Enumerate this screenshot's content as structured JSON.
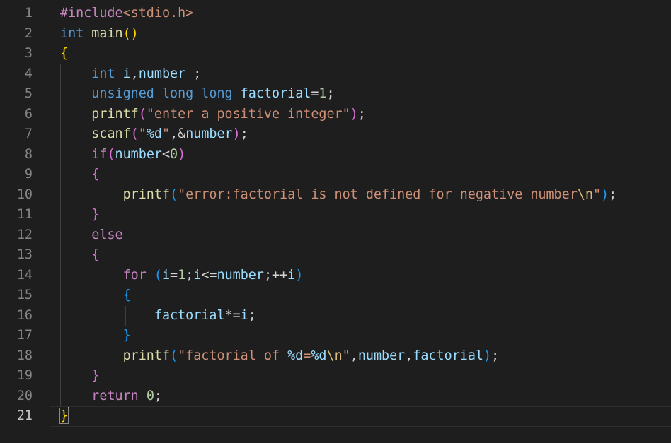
{
  "editor": {
    "language": "c",
    "current_line": 21,
    "colors": {
      "background": "#1e1e1e",
      "keyword_control": "#c586c0",
      "keyword_type": "#569cd6",
      "function": "#dcdcaa",
      "variable": "#9cdcfe",
      "string": "#ce9178",
      "number": "#b5cea8",
      "bracket_1": "#ffd700",
      "bracket_2": "#da70d6",
      "bracket_3": "#179fff",
      "line_number": "#858585"
    },
    "lines": [
      {
        "n": "1",
        "guides": 0,
        "tokens": [
          {
            "t": "#include",
            "c": "#c586c0"
          },
          {
            "t": "<stdio.h>",
            "c": "#ce9178"
          }
        ]
      },
      {
        "n": "2",
        "guides": 0,
        "tokens": [
          {
            "t": "int",
            "c": "#569cd6"
          },
          {
            "t": " ",
            "c": "#d4d4d4"
          },
          {
            "t": "main",
            "c": "#dcdcaa"
          },
          {
            "t": "()",
            "c": "#ffd700"
          }
        ]
      },
      {
        "n": "3",
        "guides": 0,
        "tokens": [
          {
            "t": "{",
            "c": "#ffd700"
          }
        ]
      },
      {
        "n": "4",
        "guides": 1,
        "tokens": [
          {
            "t": "    ",
            "c": "#d4d4d4"
          },
          {
            "t": "int",
            "c": "#569cd6"
          },
          {
            "t": " ",
            "c": "#d4d4d4"
          },
          {
            "t": "i",
            "c": "#9cdcfe"
          },
          {
            "t": ",",
            "c": "#d4d4d4"
          },
          {
            "t": "number",
            "c": "#9cdcfe"
          },
          {
            "t": " ;",
            "c": "#d4d4d4"
          }
        ]
      },
      {
        "n": "5",
        "guides": 1,
        "tokens": [
          {
            "t": "    ",
            "c": "#d4d4d4"
          },
          {
            "t": "unsigned long long",
            "c": "#569cd6"
          },
          {
            "t": " ",
            "c": "#d4d4d4"
          },
          {
            "t": "factorial",
            "c": "#9cdcfe"
          },
          {
            "t": "=",
            "c": "#d4d4d4"
          },
          {
            "t": "1",
            "c": "#b5cea8"
          },
          {
            "t": ";",
            "c": "#d4d4d4"
          }
        ]
      },
      {
        "n": "6",
        "guides": 1,
        "tokens": [
          {
            "t": "    ",
            "c": "#d4d4d4"
          },
          {
            "t": "printf",
            "c": "#dcdcaa"
          },
          {
            "t": "(",
            "c": "#da70d6"
          },
          {
            "t": "\"enter a positive integer\"",
            "c": "#ce9178"
          },
          {
            "t": ")",
            "c": "#da70d6"
          },
          {
            "t": ";",
            "c": "#d4d4d4"
          }
        ]
      },
      {
        "n": "7",
        "guides": 1,
        "tokens": [
          {
            "t": "    ",
            "c": "#d4d4d4"
          },
          {
            "t": "scanf",
            "c": "#dcdcaa"
          },
          {
            "t": "(",
            "c": "#da70d6"
          },
          {
            "t": "\"",
            "c": "#ce9178"
          },
          {
            "t": "%d",
            "c": "#9cdcfe"
          },
          {
            "t": "\"",
            "c": "#ce9178"
          },
          {
            "t": ",&",
            "c": "#d4d4d4"
          },
          {
            "t": "number",
            "c": "#9cdcfe"
          },
          {
            "t": ")",
            "c": "#da70d6"
          },
          {
            "t": ";",
            "c": "#d4d4d4"
          }
        ]
      },
      {
        "n": "8",
        "guides": 1,
        "tokens": [
          {
            "t": "    ",
            "c": "#d4d4d4"
          },
          {
            "t": "if",
            "c": "#c586c0"
          },
          {
            "t": "(",
            "c": "#da70d6"
          },
          {
            "t": "number",
            "c": "#9cdcfe"
          },
          {
            "t": "<",
            "c": "#d4d4d4"
          },
          {
            "t": "0",
            "c": "#b5cea8"
          },
          {
            "t": ")",
            "c": "#da70d6"
          }
        ]
      },
      {
        "n": "9",
        "guides": 1,
        "tokens": [
          {
            "t": "    ",
            "c": "#d4d4d4"
          },
          {
            "t": "{",
            "c": "#da70d6"
          }
        ]
      },
      {
        "n": "10",
        "guides": 2,
        "tokens": [
          {
            "t": "        ",
            "c": "#d4d4d4"
          },
          {
            "t": "printf",
            "c": "#dcdcaa"
          },
          {
            "t": "(",
            "c": "#179fff"
          },
          {
            "t": "\"error:factorial is not defined for negative number",
            "c": "#ce9178"
          },
          {
            "t": "\\n",
            "c": "#d7ba7d"
          },
          {
            "t": "\"",
            "c": "#ce9178"
          },
          {
            "t": ")",
            "c": "#179fff"
          },
          {
            "t": ";",
            "c": "#d4d4d4"
          }
        ]
      },
      {
        "n": "11",
        "guides": 1,
        "tokens": [
          {
            "t": "    ",
            "c": "#d4d4d4"
          },
          {
            "t": "}",
            "c": "#da70d6"
          }
        ]
      },
      {
        "n": "12",
        "guides": 1,
        "tokens": [
          {
            "t": "    ",
            "c": "#d4d4d4"
          },
          {
            "t": "else",
            "c": "#c586c0"
          }
        ]
      },
      {
        "n": "13",
        "guides": 1,
        "tokens": [
          {
            "t": "    ",
            "c": "#d4d4d4"
          },
          {
            "t": "{",
            "c": "#da70d6"
          }
        ]
      },
      {
        "n": "14",
        "guides": 2,
        "tokens": [
          {
            "t": "        ",
            "c": "#d4d4d4"
          },
          {
            "t": "for",
            "c": "#c586c0"
          },
          {
            "t": " ",
            "c": "#d4d4d4"
          },
          {
            "t": "(",
            "c": "#179fff"
          },
          {
            "t": "i",
            "c": "#9cdcfe"
          },
          {
            "t": "=",
            "c": "#d4d4d4"
          },
          {
            "t": "1",
            "c": "#b5cea8"
          },
          {
            "t": ";",
            "c": "#d4d4d4"
          },
          {
            "t": "i",
            "c": "#9cdcfe"
          },
          {
            "t": "<=",
            "c": "#d4d4d4"
          },
          {
            "t": "number",
            "c": "#9cdcfe"
          },
          {
            "t": ";++",
            "c": "#d4d4d4"
          },
          {
            "t": "i",
            "c": "#9cdcfe"
          },
          {
            "t": ")",
            "c": "#179fff"
          }
        ]
      },
      {
        "n": "15",
        "guides": 2,
        "tokens": [
          {
            "t": "        ",
            "c": "#d4d4d4"
          },
          {
            "t": "{",
            "c": "#179fff"
          }
        ]
      },
      {
        "n": "16",
        "guides": 3,
        "tokens": [
          {
            "t": "            ",
            "c": "#d4d4d4"
          },
          {
            "t": "factorial",
            "c": "#9cdcfe"
          },
          {
            "t": "*=",
            "c": "#d4d4d4"
          },
          {
            "t": "i",
            "c": "#9cdcfe"
          },
          {
            "t": ";",
            "c": "#d4d4d4"
          }
        ]
      },
      {
        "n": "17",
        "guides": 2,
        "tokens": [
          {
            "t": "        ",
            "c": "#d4d4d4"
          },
          {
            "t": "}",
            "c": "#179fff"
          }
        ]
      },
      {
        "n": "18",
        "guides": 2,
        "tokens": [
          {
            "t": "        ",
            "c": "#d4d4d4"
          },
          {
            "t": "printf",
            "c": "#dcdcaa"
          },
          {
            "t": "(",
            "c": "#179fff"
          },
          {
            "t": "\"factorial of ",
            "c": "#ce9178"
          },
          {
            "t": "%d",
            "c": "#9cdcfe"
          },
          {
            "t": "=",
            "c": "#ce9178"
          },
          {
            "t": "%d",
            "c": "#9cdcfe"
          },
          {
            "t": "\\n",
            "c": "#d7ba7d"
          },
          {
            "t": "\"",
            "c": "#ce9178"
          },
          {
            "t": ",",
            "c": "#d4d4d4"
          },
          {
            "t": "number",
            "c": "#9cdcfe"
          },
          {
            "t": ",",
            "c": "#d4d4d4"
          },
          {
            "t": "factorial",
            "c": "#9cdcfe"
          },
          {
            "t": ")",
            "c": "#179fff"
          },
          {
            "t": ";",
            "c": "#d4d4d4"
          }
        ]
      },
      {
        "n": "19",
        "guides": 1,
        "tokens": [
          {
            "t": "    ",
            "c": "#d4d4d4"
          },
          {
            "t": "}",
            "c": "#da70d6"
          }
        ]
      },
      {
        "n": "20",
        "guides": 1,
        "tokens": [
          {
            "t": "    ",
            "c": "#d4d4d4"
          },
          {
            "t": "return",
            "c": "#c586c0"
          },
          {
            "t": " ",
            "c": "#d4d4d4"
          },
          {
            "t": "0",
            "c": "#b5cea8"
          },
          {
            "t": ";",
            "c": "#d4d4d4"
          }
        ]
      },
      {
        "n": "21",
        "guides": 0,
        "tokens": [
          {
            "t": "}",
            "c": "#ffd700",
            "match": true
          }
        ]
      }
    ]
  }
}
